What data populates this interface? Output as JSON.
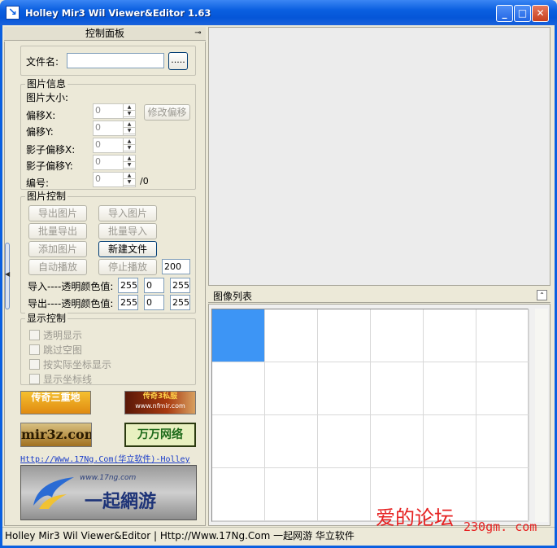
{
  "window": {
    "title": "Holley Mir3 Wil Viewer&Editor 1.63",
    "minimize_glyph": "_",
    "maximize_glyph": "□",
    "close_glyph": "✕"
  },
  "left_panel": {
    "header": "控制面板",
    "pin_glyph": "⊸",
    "file": {
      "label": "文件名:",
      "value": "",
      "browse_label": "....."
    },
    "image_info": {
      "title": "图片信息",
      "size_label": "图片大小:",
      "offset_x_label": "偏移X:",
      "offset_y_label": "偏移Y:",
      "shadow_x_label": "影子偏移X:",
      "shadow_y_label": "影子偏移Y:",
      "index_label": "编号:",
      "offset_x": "0",
      "offset_y": "0",
      "shadow_x": "0",
      "shadow_y": "0",
      "index": "0",
      "index_total": "/0",
      "modify_offset_label": "修改偏移"
    },
    "image_control": {
      "title": "图片控制",
      "export_image": "导出图片",
      "import_image": "导入图片",
      "batch_export": "批量导出",
      "batch_import": "批量导入",
      "add_image": "添加图片",
      "new_file": "新建文件",
      "auto_play": "自动播放",
      "stop_play": "停止播放",
      "play_interval": "200",
      "import_color_label": "导入----透明颜色值:",
      "import_color": [
        "255",
        "0",
        "255"
      ],
      "export_color_label": "导出----透明颜色值:",
      "export_color": [
        "255",
        "0",
        "255"
      ]
    },
    "display_control": {
      "title": "显示控制",
      "transparent": "透明显示",
      "skip_empty": "跳过空图",
      "actual_coords": "按实际坐标显示",
      "show_coords": "显示坐标线"
    },
    "ads": {
      "ad1": "传奇三重地",
      "ad2": "传奇3私服",
      "ad2_url": "www.nfmir.com",
      "ad3": "mir3z.com",
      "ad4": "万万网络",
      "link": "Http://Www.17Ng.Com(华立软件)-Holley",
      "banner_url": "www.17ng.com",
      "banner_text": "一起網游"
    }
  },
  "image_list": {
    "title": "图像列表",
    "collapse_glyph": "⌃",
    "columns": 6,
    "rows": 4,
    "selected_index": 0
  },
  "status_bar": {
    "text": "Holley Mir3 Wil Viewer&Editor  |  Http://Www.17Ng.Com 一起网游 华立软件"
  },
  "watermark": {
    "main": "爱的论坛",
    "sub": "230gm. com"
  },
  "colors": {
    "title_blue": "#0a5fe0",
    "selection_blue": "#3d95f5",
    "watermark_red": "#e62020"
  }
}
